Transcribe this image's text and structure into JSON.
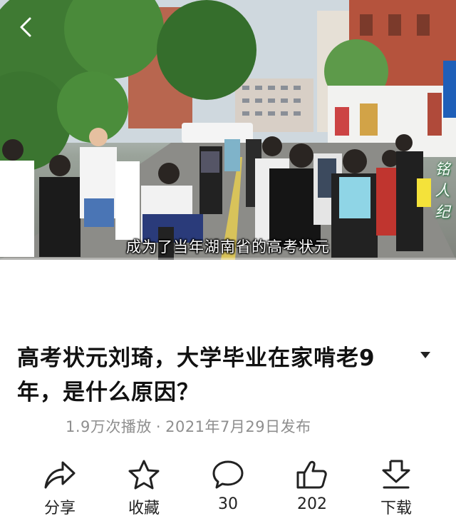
{
  "video": {
    "subtitle": "成为了当年湖南省的高考状元",
    "watermark": "铭人纪",
    "progress_fraction": 0.0
  },
  "info": {
    "title": "高考状元刘琦，大学毕业在家啃老9年，是什么原因？",
    "views": "1.9万次播放",
    "separator": "·",
    "published": "2021年7月29日发布"
  },
  "actions": {
    "share": "分享",
    "favorite": "收藏",
    "comments": "30",
    "likes": "202",
    "download": "下载"
  },
  "colors": {
    "accent": "#ff2d55",
    "text": "#111111",
    "meta": "#8e8e8e"
  },
  "icons": {
    "back": "chevron-left-icon",
    "expand": "caret-down-icon",
    "share": "share-arrow-icon",
    "favorite": "star-icon",
    "comments": "comment-bubble-icon",
    "likes": "thumbs-up-icon",
    "download": "download-icon"
  }
}
